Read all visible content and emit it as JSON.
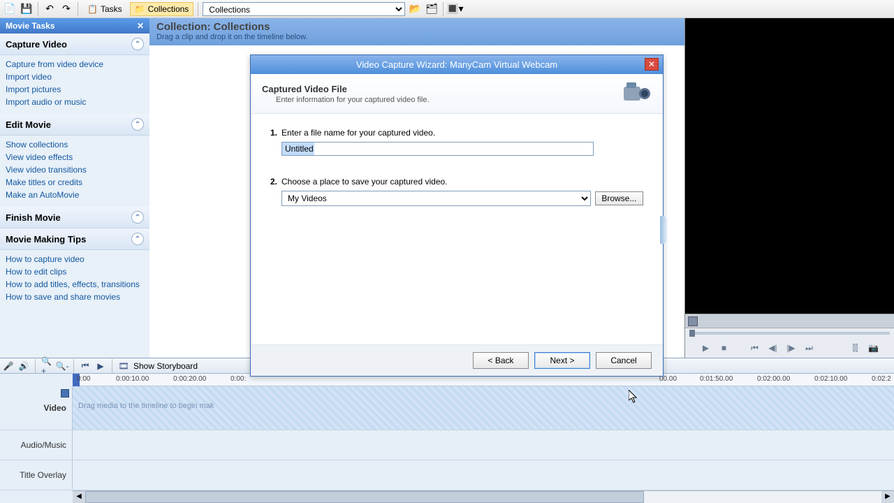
{
  "toolbar": {
    "tasks_label": "Tasks",
    "collections_label": "Collections",
    "dropdown_value": "Collections"
  },
  "sidebar": {
    "header": "Movie Tasks",
    "sections": [
      {
        "title": "Capture Video",
        "links": [
          "Capture from video device",
          "Import video",
          "Import pictures",
          "Import audio or music"
        ]
      },
      {
        "title": "Edit Movie",
        "links": [
          "Show collections",
          "View video effects",
          "View video transitions",
          "Make titles or credits",
          "Make an AutoMovie"
        ]
      },
      {
        "title": "Finish Movie",
        "links": []
      },
      {
        "title": "Movie Making Tips",
        "links": [
          "How to capture video",
          "How to edit clips",
          "How to add titles, effects, transitions",
          "How to save and share movies"
        ]
      }
    ]
  },
  "collection": {
    "title": "Collection: Collections",
    "subtitle": "Drag a clip and drop it on the timeline below."
  },
  "dialog": {
    "title": "Video Capture Wizard: ManyCam Virtual Webcam",
    "head_title": "Captured Video File",
    "head_sub": "Enter information for your captured video file.",
    "step1_label": "Enter a file name for your captured video.",
    "filename_value": "Untitled",
    "step2_label": "Choose a place to save your captured video.",
    "folder_value": "My Videos",
    "browse_label": "Browse...",
    "back_label": "< Back",
    "next_label": "Next >",
    "cancel_label": "Cancel"
  },
  "timeline": {
    "show_storyboard": "Show Storyboard",
    "marks": [
      "0:00",
      "0:00:10.00",
      "0:00:20.00",
      "0:00:",
      "00.00",
      "0:01:50.00",
      "0:02:00.00",
      "0:02:10.00",
      "0:02:2"
    ],
    "video_label": "Video",
    "video_hint": "Drag media to the timeline to begin mak",
    "audio_label": "Audio/Music",
    "title_label": "Title Overlay"
  }
}
